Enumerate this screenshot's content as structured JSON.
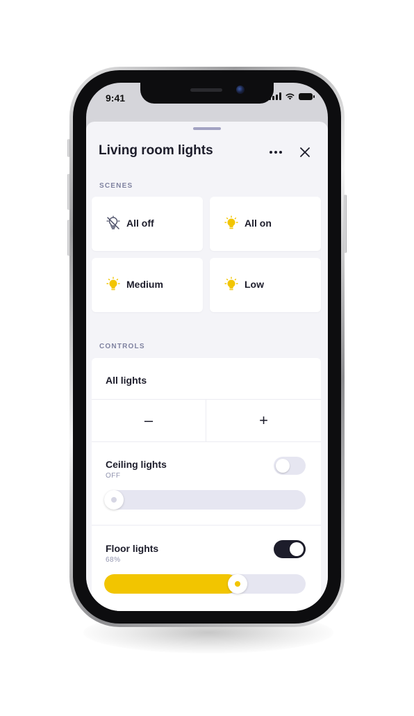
{
  "status_bar": {
    "time": "9:41"
  },
  "sheet": {
    "title": "Living room lights"
  },
  "scenes": {
    "section_label": "SCENES",
    "items": [
      {
        "label": "All off",
        "icon": "bulb-off-icon"
      },
      {
        "label": "All on",
        "icon": "bulb-icon"
      },
      {
        "label": "Medium",
        "icon": "bulb-icon"
      },
      {
        "label": "Low",
        "icon": "bulb-icon"
      }
    ]
  },
  "controls": {
    "section_label": "CONTROLS",
    "all_lights": {
      "label": "All lights",
      "decrease": "–",
      "increase": "+"
    },
    "ceiling": {
      "label": "Ceiling lights",
      "status": "OFF",
      "on": false,
      "level": 0
    },
    "floor": {
      "label": "Floor lights",
      "status": "68%",
      "on": true,
      "level": 0.68
    }
  },
  "colors": {
    "accent": "#f2c500",
    "toggle_on": "#1d1d2b",
    "toggle_off": "#e6e6f1",
    "text_primary": "#1d1d2b",
    "text_secondary": "#8f92ad",
    "sheet_bg": "#f4f4f8"
  }
}
